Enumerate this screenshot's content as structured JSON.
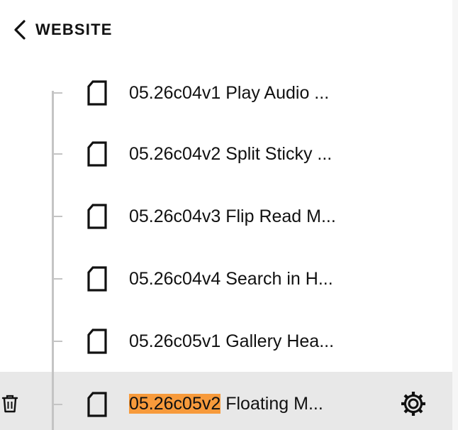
{
  "header": {
    "back_label": "WEBSITE"
  },
  "pages": [
    {
      "label": "05.26c04v1 Play Audio ..."
    },
    {
      "label": "05.26c04v2 Split Sticky ..."
    },
    {
      "label": "05.26c04v3 Flip Read M..."
    },
    {
      "label": "05.26c04v4 Search in H..."
    },
    {
      "label": "05.26c05v1 Gallery Hea..."
    },
    {
      "label_highlight": "05.26c05v2",
      "label_rest": " Floating M..."
    }
  ],
  "icons": {
    "back": "chevron-left-icon",
    "page": "page-icon",
    "trash": "trash-icon",
    "settings": "gear-icon"
  },
  "colors": {
    "highlight": "#f79a3b",
    "selected_row": "#e8e8e8",
    "tree_line": "#c4c4c4"
  }
}
